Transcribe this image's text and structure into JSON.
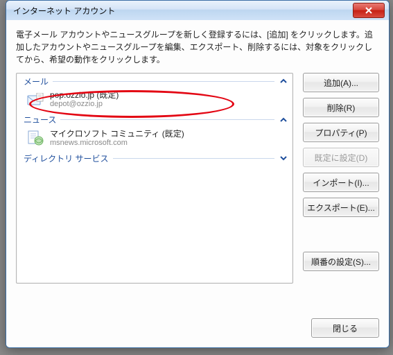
{
  "window": {
    "title": "インターネット アカウント"
  },
  "description": "電子メール アカウントやニュースグループを新しく登録するには、[追加] をクリックします。追加したアカウントやニュースグループを編集、エクスポート、削除するには、対象をクリックしてから、希望の動作をクリックします。",
  "sections": {
    "mail": {
      "label": "メール",
      "items": [
        {
          "title": "pop.ozzio.jp (既定)",
          "subtitle": "depot@ozzio.jp"
        }
      ]
    },
    "news": {
      "label": "ニュース",
      "items": [
        {
          "title": "マイクロソフト コミュニティ (既定)",
          "subtitle": "msnews.microsoft.com"
        }
      ]
    },
    "directory": {
      "label": "ディレクトリ サービス"
    }
  },
  "buttons": {
    "add": "追加(A)...",
    "remove": "削除(R)",
    "properties": "プロパティ(P)",
    "set_default": "既定に設定(D)",
    "import": "インポート(I)...",
    "export": "エクスポート(E)...",
    "set_order": "順番の設定(S)...",
    "close": "閉じる"
  }
}
